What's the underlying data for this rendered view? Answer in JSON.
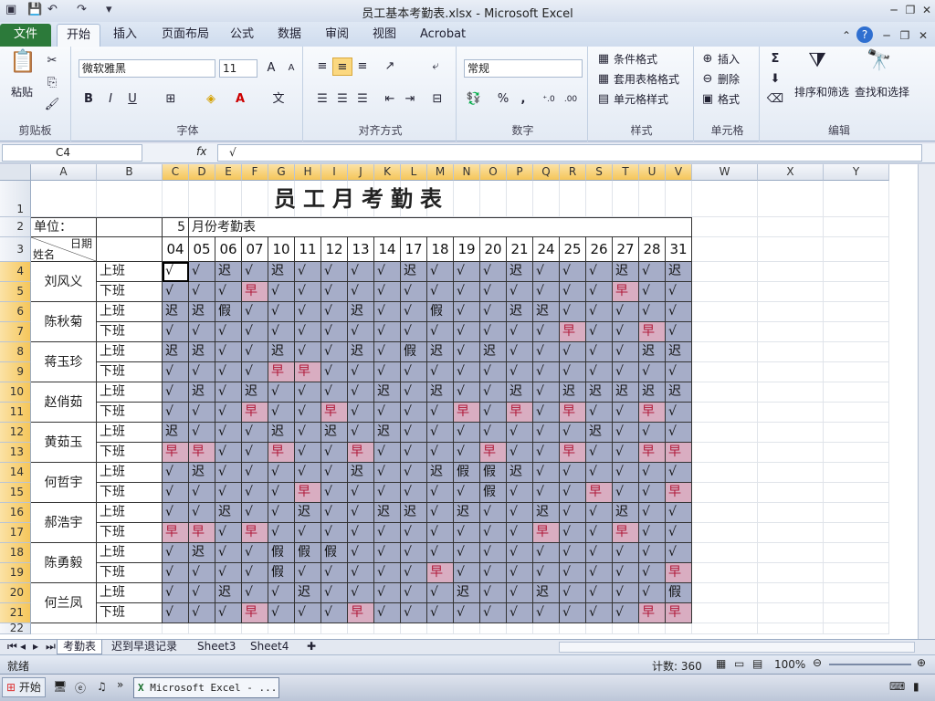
{
  "window": {
    "title": "员工基本考勤表.xlsx - Microsoft Excel"
  },
  "ribbon_tabs": [
    "文件",
    "开始",
    "插入",
    "页面布局",
    "公式",
    "数据",
    "审阅",
    "视图",
    "Acrobat"
  ],
  "ribbon": {
    "clipboard": {
      "label": "剪贴板",
      "paste": "粘贴"
    },
    "font": {
      "label": "字体",
      "name": "微软雅黑",
      "size": "11",
      "bold": "B",
      "italic": "I",
      "underline": "U"
    },
    "alignment": {
      "label": "对齐方式"
    },
    "number": {
      "label": "数字",
      "format": "常规",
      "percent": "%",
      "comma": ","
    },
    "styles": {
      "label": "样式",
      "cond": "条件格式",
      "table": "套用表格格式",
      "cell": "单元格样式"
    },
    "cells": {
      "label": "单元格",
      "insert": "插入",
      "delete": "删除",
      "format": "格式"
    },
    "editing": {
      "label": "编辑",
      "sum": "Σ",
      "sort": "排序和筛选",
      "find": "查找和选择"
    }
  },
  "formula_bar": {
    "name_box": "C4",
    "fx": "fx",
    "content": "√"
  },
  "columns": [
    "A",
    "B",
    "C",
    "D",
    "E",
    "F",
    "G",
    "H",
    "I",
    "J",
    "K",
    "L",
    "M",
    "N",
    "O",
    "P",
    "Q",
    "R",
    "S",
    "T",
    "U",
    "V",
    "W",
    "X",
    "Y"
  ],
  "row_numbers": [
    "1",
    "2",
    "3",
    "4",
    "5",
    "6",
    "7",
    "8",
    "9",
    "10",
    "11",
    "12",
    "13",
    "14",
    "15",
    "16",
    "17",
    "18",
    "19",
    "20",
    "21",
    "22"
  ],
  "sheet": {
    "title": "员工月考勤表",
    "unit_label": "单位：",
    "month_value": "5",
    "month_suffix": "月份考勤表",
    "corner_date": "日期",
    "corner_name": "姓名",
    "dates": [
      "04",
      "05",
      "06",
      "07",
      "10",
      "11",
      "12",
      "13",
      "14",
      "17",
      "18",
      "19",
      "20",
      "21",
      "24",
      "25",
      "26",
      "27",
      "28",
      "31"
    ],
    "shift_on": "上班",
    "shift_off": "下班",
    "employees": [
      {
        "name": "刘风义",
        "on": [
          "√",
          "√",
          "迟",
          "√",
          "迟",
          "√",
          "√",
          "√",
          "√",
          "迟",
          "√",
          "√",
          "√",
          "迟",
          "√",
          "√",
          "√",
          "迟",
          "√",
          "迟"
        ],
        "off": [
          "√",
          "√",
          "√",
          "早",
          "√",
          "√",
          "√",
          "√",
          "√",
          "√",
          "√",
          "√",
          "√",
          "√",
          "√",
          "√",
          "√",
          "早",
          "√",
          "√"
        ]
      },
      {
        "name": "陈秋菊",
        "on": [
          "迟",
          "迟",
          "假",
          "√",
          "√",
          "√",
          "√",
          "迟",
          "√",
          "√",
          "假",
          "√",
          "√",
          "迟",
          "迟",
          "√",
          "√",
          "√",
          "√",
          "√"
        ],
        "off": [
          "√",
          "√",
          "√",
          "√",
          "√",
          "√",
          "√",
          "√",
          "√",
          "√",
          "√",
          "√",
          "√",
          "√",
          "√",
          "早",
          "√",
          "√",
          "早",
          "√"
        ]
      },
      {
        "name": "蒋玉珍",
        "on": [
          "迟",
          "迟",
          "√",
          "√",
          "迟",
          "√",
          "√",
          "迟",
          "√",
          "假",
          "迟",
          "√",
          "迟",
          "√",
          "√",
          "√",
          "√",
          "√",
          "迟",
          "迟"
        ],
        "off": [
          "√",
          "√",
          "√",
          "√",
          "早",
          "早",
          "√",
          "√",
          "√",
          "√",
          "√",
          "√",
          "√",
          "√",
          "√",
          "√",
          "√",
          "√",
          "√",
          "√"
        ]
      },
      {
        "name": "赵俏茹",
        "on": [
          "√",
          "迟",
          "√",
          "迟",
          "√",
          "√",
          "√",
          "√",
          "迟",
          "√",
          "迟",
          "√",
          "√",
          "迟",
          "√",
          "迟",
          "迟",
          "迟",
          "迟",
          "迟"
        ],
        "off": [
          "√",
          "√",
          "√",
          "早",
          "√",
          "√",
          "早",
          "√",
          "√",
          "√",
          "√",
          "早",
          "√",
          "早",
          "√",
          "早",
          "√",
          "√",
          "早",
          "√"
        ]
      },
      {
        "name": "黄茹玉",
        "on": [
          "迟",
          "√",
          "√",
          "√",
          "迟",
          "√",
          "迟",
          "√",
          "迟",
          "√",
          "√",
          "√",
          "√",
          "√",
          "√",
          "√",
          "迟",
          "√",
          "√",
          "√"
        ],
        "off": [
          "早",
          "早",
          "√",
          "√",
          "早",
          "√",
          "√",
          "早",
          "√",
          "√",
          "√",
          "√",
          "早",
          "√",
          "√",
          "早",
          "√",
          "√",
          "早",
          "早"
        ]
      },
      {
        "name": "何哲宇",
        "on": [
          "√",
          "迟",
          "√",
          "√",
          "√",
          "√",
          "√",
          "迟",
          "√",
          "√",
          "迟",
          "假",
          "假",
          "迟",
          "√",
          "√",
          "√",
          "√",
          "√",
          "√"
        ],
        "off": [
          "√",
          "√",
          "√",
          "√",
          "√",
          "早",
          "√",
          "√",
          "√",
          "√",
          "√",
          "√",
          "假",
          "√",
          "√",
          "√",
          "早",
          "√",
          "√",
          "早"
        ]
      },
      {
        "name": "郝浩宇",
        "on": [
          "√",
          "√",
          "迟",
          "√",
          "√",
          "迟",
          "√",
          "√",
          "迟",
          "迟",
          "√",
          "迟",
          "√",
          "√",
          "迟",
          "√",
          "√",
          "迟",
          "√",
          "√"
        ],
        "off": [
          "早",
          "早",
          "√",
          "早",
          "√",
          "√",
          "√",
          "√",
          "√",
          "√",
          "√",
          "√",
          "√",
          "√",
          "早",
          "√",
          "√",
          "早",
          "√",
          "√"
        ]
      },
      {
        "name": "陈勇毅",
        "on": [
          "√",
          "迟",
          "√",
          "√",
          "假",
          "假",
          "假",
          "√",
          "√",
          "√",
          "√",
          "√",
          "√",
          "√",
          "√",
          "√",
          "√",
          "√",
          "√",
          "√"
        ],
        "off": [
          "√",
          "√",
          "√",
          "√",
          "假",
          "√",
          "√",
          "√",
          "√",
          "√",
          "早",
          "√",
          "√",
          "√",
          "√",
          "√",
          "√",
          "√",
          "√",
          "早"
        ]
      },
      {
        "name": "何兰凤",
        "on": [
          "√",
          "√",
          "迟",
          "√",
          "√",
          "迟",
          "√",
          "√",
          "√",
          "√",
          "√",
          "迟",
          "√",
          "√",
          "迟",
          "√",
          "√",
          "√",
          "√",
          "假"
        ],
        "off": [
          "√",
          "√",
          "√",
          "早",
          "√",
          "√",
          "√",
          "早",
          "√",
          "√",
          "√",
          "√",
          "√",
          "√",
          "√",
          "√",
          "√",
          "√",
          "早",
          "早"
        ]
      }
    ]
  },
  "sheet_tabs": [
    "考勤表",
    "迟到早退记录",
    "Sheet3",
    "Sheet4"
  ],
  "status": {
    "ready": "就绪",
    "count": "计数: 360",
    "zoom": "100%"
  },
  "taskbar": {
    "start": "开始",
    "app": "Microsoft Excel - ..."
  }
}
